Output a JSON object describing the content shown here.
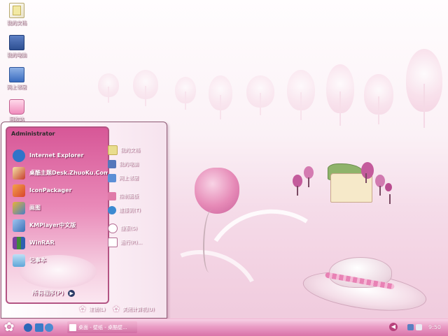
{
  "desktop": {
    "icons": [
      {
        "label": "我的文档",
        "icon": "documents-folder-icon"
      },
      {
        "label": "我的电脑",
        "icon": "computer-icon"
      },
      {
        "label": "网上邻居",
        "icon": "network-places-icon"
      },
      {
        "label": "回收站",
        "icon": "recycle-bin-icon"
      }
    ]
  },
  "start_menu": {
    "user": "Administrator",
    "programs": [
      {
        "label": "Internet Explorer",
        "icon": "internet-explorer-icon",
        "color": "#2f74c9"
      },
      {
        "label": "桌酷主题Desk.ZhuoKu.Com",
        "icon": "theme-app-icon",
        "color": "#c63d2f"
      },
      {
        "label": "IconPackager",
        "icon": "iconpackager-icon",
        "color": "#d9432e"
      },
      {
        "label": "画图",
        "icon": "paint-icon",
        "color": "#e5b23a"
      },
      {
        "label": "KMPlayer中文版",
        "icon": "kmplayer-icon",
        "color": "#3b6fb6"
      },
      {
        "label": "WinRAR",
        "icon": "winrar-icon",
        "color": "#7b3fa0"
      },
      {
        "label": "记事本",
        "icon": "notepad-icon",
        "color": "#5ea6d8"
      }
    ],
    "all_programs": "所有程序(P)",
    "places": [
      {
        "label": "我的文档",
        "icon": "documents-icon",
        "color": "#e9dd8e"
      },
      {
        "label": "我的电脑",
        "icon": "my-computer-icon",
        "color": "#5577bb"
      },
      {
        "label": "网上邻居",
        "icon": "network-icon",
        "color": "#5c8fd6"
      }
    ],
    "settings": [
      {
        "label": "控制面板",
        "icon": "control-panel-icon",
        "color": "#e07aa9"
      },
      {
        "label": "连接到(T)",
        "icon": "connect-to-icon",
        "color": "#3c8ad1"
      }
    ],
    "tools": [
      {
        "label": "搜索(S)",
        "icon": "search-icon",
        "color": "#ffffff"
      },
      {
        "label": "运行(R)...",
        "icon": "run-icon",
        "color": "#ffffff"
      }
    ],
    "logoff": "注销(L)",
    "shutdown": "关闭计算机(U)"
  },
  "taskbar": {
    "start_icon": "flower-start-icon",
    "quick_launch": [
      {
        "icon": "ie-quicklaunch-icon",
        "color": "#2c67b8"
      },
      {
        "icon": "desktop-quicklaunch-icon",
        "color": "#3a7bc8"
      },
      {
        "icon": "browser-quicklaunch-icon",
        "color": "#4b8bd0"
      }
    ],
    "task": "桌面 - 壁纸 - 桌酷壁...",
    "tray_icons": [
      {
        "icon": "network-tray-icon",
        "color": "#5a7fc0"
      },
      {
        "icon": "volume-tray-icon",
        "color": "#e9e9f2"
      }
    ],
    "clock": "9:50"
  }
}
